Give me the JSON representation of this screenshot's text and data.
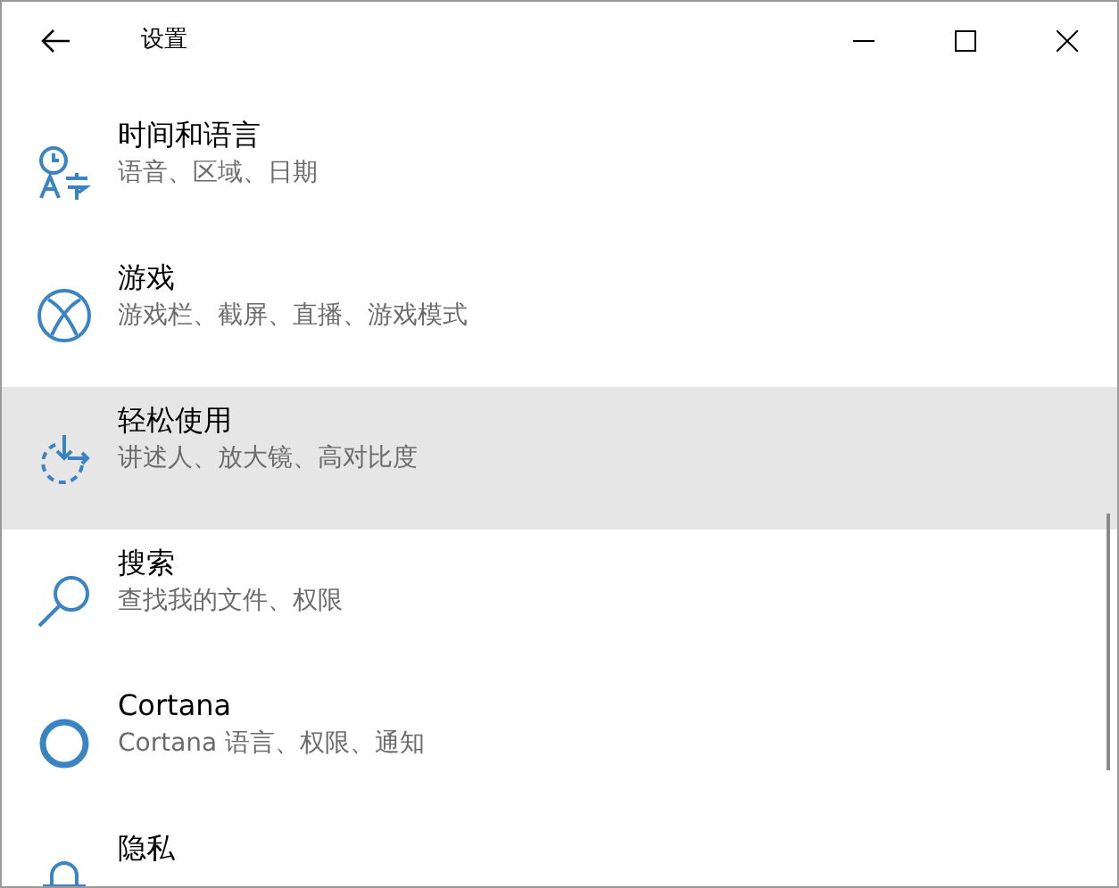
{
  "window": {
    "title": "设置"
  },
  "items": [
    {
      "kind": "time-language",
      "title": "时间和语言",
      "subtitle": "语音、区域、日期",
      "selected": false
    },
    {
      "kind": "gaming",
      "title": "游戏",
      "subtitle": "游戏栏、截屏、直播、游戏模式",
      "selected": false
    },
    {
      "kind": "ease-of-access",
      "title": "轻松使用",
      "subtitle": "讲述人、放大镜、高对比度",
      "selected": true
    },
    {
      "kind": "search",
      "title": "搜索",
      "subtitle": "查找我的文件、权限",
      "selected": false
    },
    {
      "kind": "cortana",
      "title": "Cortana",
      "subtitle": "Cortana 语言、权限、通知",
      "selected": false
    },
    {
      "kind": "privacy",
      "title": "隐私",
      "selected": false
    }
  ]
}
